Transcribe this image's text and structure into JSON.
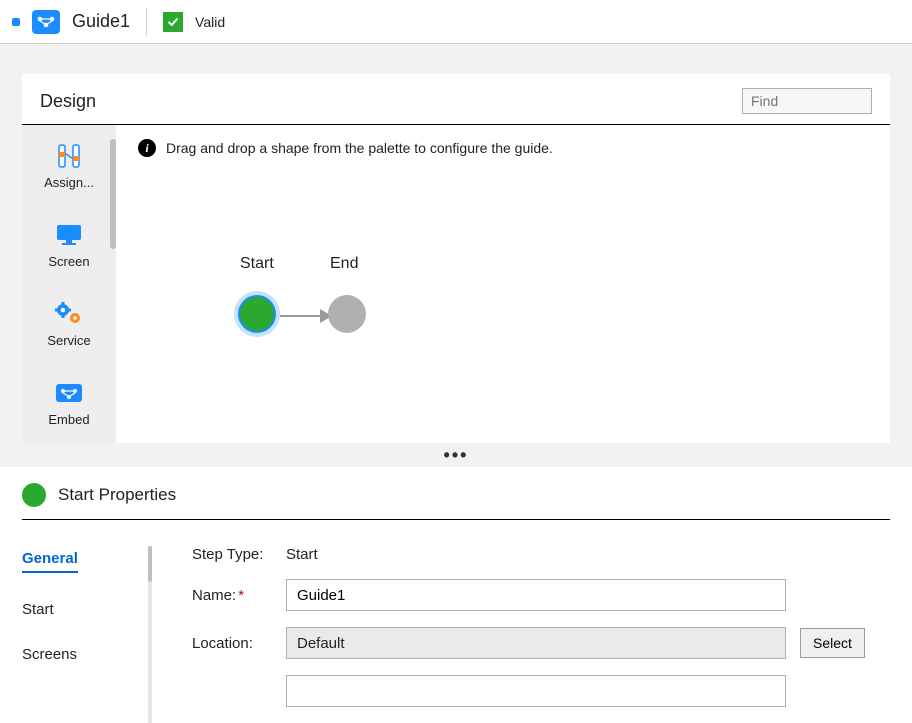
{
  "header": {
    "title": "Guide1",
    "valid_label": "Valid"
  },
  "design": {
    "title": "Design",
    "find_placeholder": "Find",
    "hint": "Drag and drop a shape from the palette to configure the guide.",
    "palette": [
      {
        "label": "Assign..."
      },
      {
        "label": "Screen"
      },
      {
        "label": "Service"
      },
      {
        "label": "Embed"
      }
    ],
    "nodes": {
      "start_label": "Start",
      "end_label": "End"
    }
  },
  "properties": {
    "title": "Start Properties",
    "nav": [
      {
        "label": "General",
        "active": true
      },
      {
        "label": "Start",
        "active": false
      },
      {
        "label": "Screens",
        "active": false
      }
    ],
    "form": {
      "step_type_label": "Step Type:",
      "step_type_value": "Start",
      "name_label": "Name:",
      "name_value": "Guide1",
      "location_label": "Location:",
      "location_value": "Default",
      "select_button": "Select"
    }
  }
}
